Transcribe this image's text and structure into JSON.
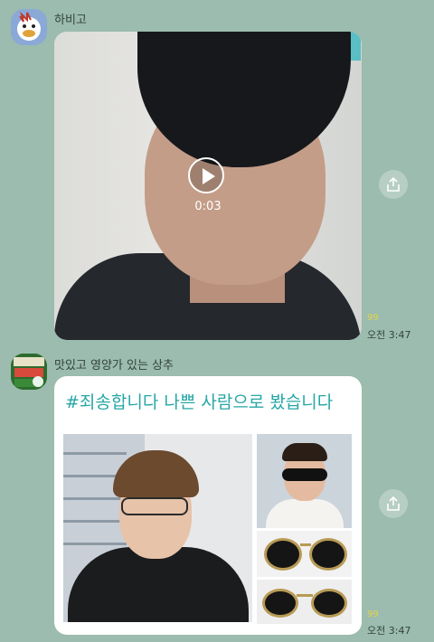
{
  "messages": [
    {
      "sender": "하비고",
      "video": {
        "duration": "0:03"
      },
      "reaction": "99",
      "time": "오전 3:47"
    },
    {
      "sender": "맛있고 영양가 있는 상추",
      "card": {
        "title": "#죄송합니다 나쁜 사람으로 봤습니다"
      },
      "reaction": "99",
      "time": "오전 3:47"
    }
  ],
  "colors": {
    "chat_background": "#9bbcae",
    "card_title": "#27a6a6",
    "reaction": "#e5d34a"
  },
  "icons": [
    "share-icon",
    "play-icon"
  ]
}
